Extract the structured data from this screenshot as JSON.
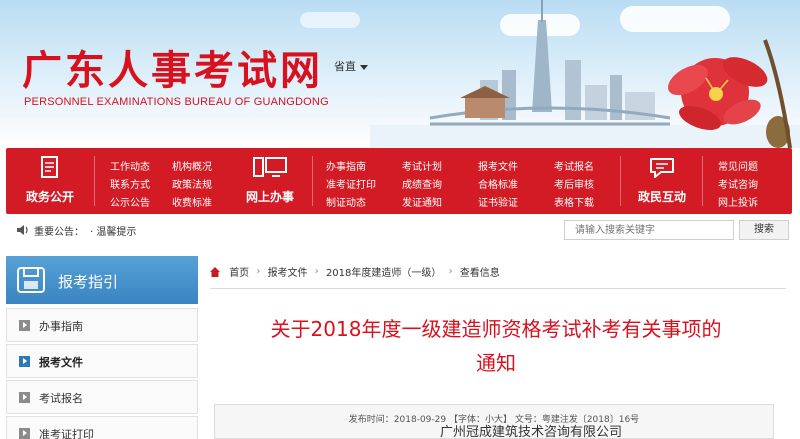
{
  "header": {
    "title": "广东人事考试网",
    "subtitle": "PERSONNEL EXAMINATIONS BUREAU OF GUANGDONG",
    "province_select": "省直"
  },
  "nav": {
    "groups": [
      {
        "icon": "document-icon",
        "label": "政务公开",
        "links": [
          "工作动态",
          "机构概况",
          "联系方式",
          "政策法规",
          "公示公告",
          "收费标准"
        ]
      },
      {
        "icon": "computer-icon",
        "label": "网上办事",
        "links": [
          "办事指南",
          "考试计划",
          "报考文件",
          "考试报名",
          "准考证打印",
          "成绩查询",
          "合格标准",
          "考后审核",
          "制证动态",
          "发证通知",
          "证书验证",
          "表格下载"
        ]
      },
      {
        "icon": "chat-icon",
        "label": "政民互动",
        "links": [
          "常见问题",
          "考试咨询",
          "网上投诉"
        ]
      }
    ]
  },
  "notice": {
    "label": "重要公告：",
    "text": "· 温馨提示"
  },
  "search": {
    "placeholder": "请输入搜索关键字",
    "button": "搜索"
  },
  "sidebar": {
    "title": "报考指引",
    "items": [
      {
        "label": "办事指南",
        "active": false
      },
      {
        "label": "报考文件",
        "active": true
      },
      {
        "label": "考试报名",
        "active": false
      },
      {
        "label": "准考证打印",
        "active": false
      }
    ]
  },
  "breadcrumb": [
    "首页",
    "报考文件",
    "2018年度建造师（一级）",
    "查看信息"
  ],
  "article": {
    "title_line1": "关于2018年度一级建造师资格考试补考有关事项的",
    "title_line2": "通知",
    "meta": "发布时间：2018-09-29 【字体：小大】 文号：粤建注发〔2018〕16号"
  },
  "watermark": "广州冠成建筑技术咨询有限公司",
  "colors": {
    "brand_red": "#d21b24",
    "title_red": "#d7111d",
    "sidebar_blue": "#3a84c2"
  }
}
